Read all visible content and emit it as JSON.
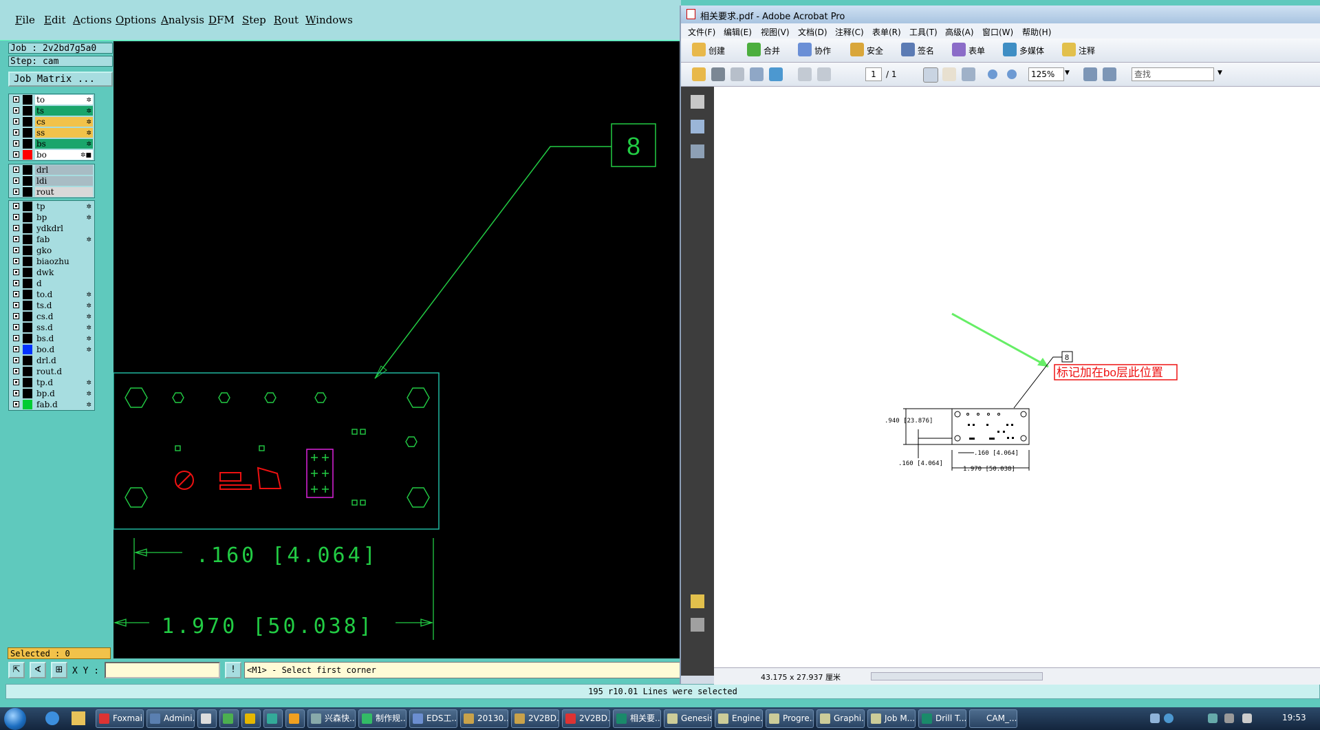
{
  "genesis": {
    "menu": [
      "File",
      "Edit",
      "Actions",
      "Options",
      "Analysis",
      "DFM",
      "Step",
      "Rout",
      "Windows"
    ],
    "job_line": "Job : 2v2bd7g5a0",
    "step_line": "Step: cam",
    "job_matrix_label": "Job Matrix ...",
    "layer_groups": [
      [
        {
          "name": "to",
          "color": "#ffffff",
          "flag": "✲"
        },
        {
          "name": "ts",
          "color": "#1aa56b",
          "flag": "✲"
        },
        {
          "name": "cs",
          "color": "#f2c24a",
          "flag": "✲"
        },
        {
          "name": "ss",
          "color": "#f2c24a",
          "flag": "✲"
        },
        {
          "name": "bs",
          "color": "#1aa56b",
          "flag": "✲"
        },
        {
          "name": "bo",
          "color": "#ffffff",
          "flag": "✲■",
          "swatch": "#ff0000",
          "active": true
        }
      ],
      [
        {
          "name": "drl",
          "color": "#a8bcc4"
        },
        {
          "name": "ldi",
          "color": "#a8bcc4"
        },
        {
          "name": "rout",
          "color": "#d8d8d8"
        }
      ],
      [
        {
          "name": "tp",
          "color": "#a7dde0",
          "flag": "✲"
        },
        {
          "name": "bp",
          "color": "#a7dde0",
          "flag": "✲"
        },
        {
          "name": "ydkdrl",
          "color": "#a7dde0"
        },
        {
          "name": "fab",
          "color": "#a7dde0",
          "flag": "✲"
        },
        {
          "name": "gko",
          "color": "#a7dde0"
        },
        {
          "name": "biaozhu",
          "color": "#a7dde0"
        },
        {
          "name": "dwk",
          "color": "#a7dde0"
        },
        {
          "name": "d",
          "color": "#a7dde0"
        },
        {
          "name": "to.d",
          "color": "#a7dde0",
          "flag": "✲"
        },
        {
          "name": "ts.d",
          "color": "#a7dde0",
          "flag": "✲"
        },
        {
          "name": "cs.d",
          "color": "#a7dde0",
          "flag": "✲"
        },
        {
          "name": "ss.d",
          "color": "#a7dde0",
          "flag": "✲"
        },
        {
          "name": "bs.d",
          "color": "#a7dde0",
          "flag": "✲"
        },
        {
          "name": "bo.d",
          "color": "#a7dde0",
          "flag": "✲",
          "swatch": "#0033ff"
        },
        {
          "name": "drl.d",
          "color": "#a7dde0"
        },
        {
          "name": "rout.d",
          "color": "#a7dde0"
        },
        {
          "name": "tp.d",
          "color": "#a7dde0",
          "flag": "✲"
        },
        {
          "name": "bp.d",
          "color": "#a7dde0",
          "flag": "✲"
        },
        {
          "name": "fab.d",
          "color": "#a7dde0",
          "flag": "✲",
          "swatch": "#00cc33"
        }
      ]
    ],
    "selected_label": "Selected : 0",
    "xy_label": "X Y :",
    "xy_value": "",
    "prompt": "<M1> - Select first corner",
    "status": "195 r10.01 Lines were selected",
    "canvas": {
      "balloon_number": "8",
      "dim1": ".160 [4.064]",
      "dim2": "1.970 [50.038]"
    }
  },
  "acrobat": {
    "title": "相关要求.pdf - Adobe Acrobat Pro",
    "menu": [
      "文件(F)",
      "编辑(E)",
      "视图(V)",
      "文档(D)",
      "注释(C)",
      "表单(R)",
      "工具(T)",
      "高级(A)",
      "窗口(W)",
      "帮助(H)"
    ],
    "toolbar": [
      "创建",
      "合并",
      "协作",
      "安全",
      "签名",
      "表单",
      "多媒体",
      "注释"
    ],
    "page_current": "1",
    "page_total": "/ 1",
    "zoom": "125%",
    "search_placeholder": "查找",
    "page_size": "43.175 x 27.937 厘米",
    "drawing": {
      "balloon": "8",
      "annotation": "标记加在bo层此位置",
      "dim_height": ".940 [23.876]",
      "dim_left": ".160 [4.064]",
      "dim_bottom_left": ".160 [4.064]",
      "dim_width": "1.970 [50.038]"
    }
  },
  "taskbar": {
    "tasks": [
      "Foxmail",
      "Admini...",
      "",
      "",
      "",
      "",
      "",
      "兴森快...",
      "制作规...",
      "EDS工...",
      "20130...",
      "2V2BD...",
      "2V2BD...",
      "相关要...",
      "Genesis",
      "Engine...",
      "Progre...",
      "Graphi...",
      "Job M...",
      "Drill T...",
      "CAM_..."
    ],
    "clock": "19:53"
  }
}
